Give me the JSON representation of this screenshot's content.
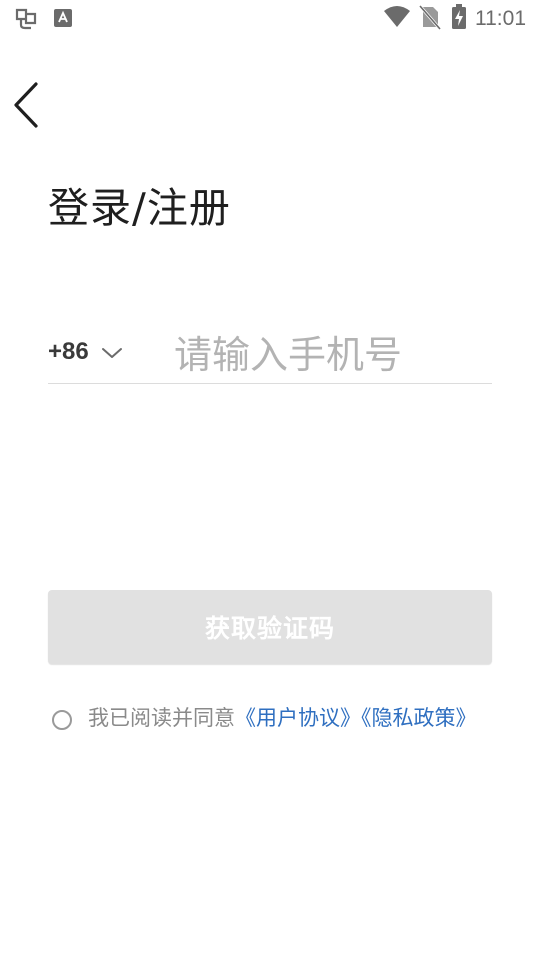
{
  "status_bar": {
    "time": "11:01",
    "left_icons": [
      "app-notification-icon",
      "keyboard-a-icon"
    ],
    "right_icons": [
      "wifi-icon",
      "no-sim-icon",
      "battery-charging-icon"
    ]
  },
  "nav": {
    "back_icon": "back-arrow-icon"
  },
  "title": "登录/注册",
  "phone": {
    "country_code": "+86",
    "chevron_icon": "chevron-down-icon",
    "placeholder": "请输入手机号",
    "value": ""
  },
  "get_code_button": {
    "label": "获取验证码",
    "state": "disabled"
  },
  "agreement": {
    "checked": false,
    "prefix": "我已阅读并同意",
    "user_agreement": "《用户协议》",
    "privacy_policy": "《隐私政策》"
  },
  "colors": {
    "link": "#2f6fc0",
    "button_disabled_bg": "#e1e1e1",
    "title": "#1f1f1f",
    "placeholder": "#b3b3b3",
    "muted_text": "#8a8a8a"
  }
}
